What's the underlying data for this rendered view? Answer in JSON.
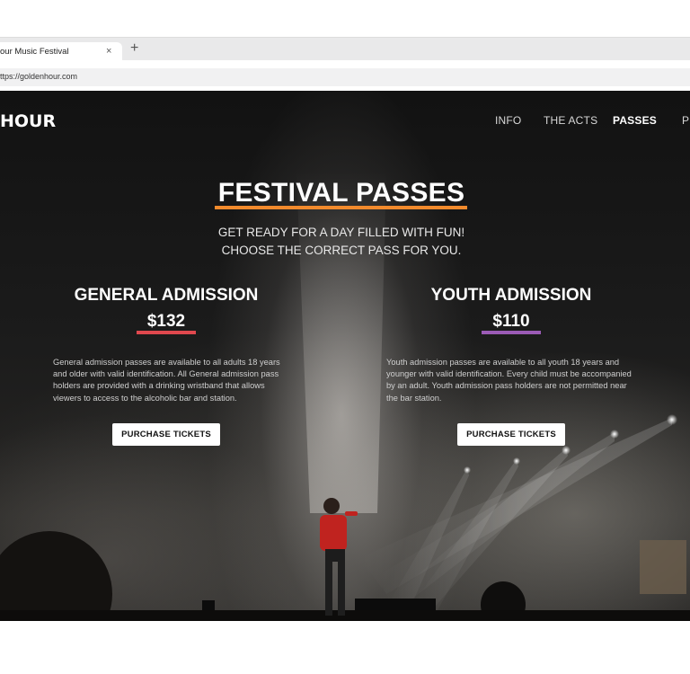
{
  "browser": {
    "tab_title": "our Music Festival",
    "tab_close": "×",
    "new_tab": "+",
    "url": "ttps://goldenhour.com"
  },
  "site": {
    "logo": "HOUR",
    "nav": [
      {
        "label": "INFO",
        "active": false
      },
      {
        "label": "THE ACTS",
        "active": false
      },
      {
        "label": "PASSES",
        "active": true
      },
      {
        "label": "PI",
        "active": false
      }
    ]
  },
  "hero": {
    "title": "FESTIVAL PASSES",
    "subtitle_line1": "GET READY FOR A DAY FILLED WITH FUN!",
    "subtitle_line2": "CHOOSE THE CORRECT PASS FOR YOU."
  },
  "passes": [
    {
      "name": "GENERAL ADMISSION",
      "price": "$132",
      "accent": "#e0484e",
      "description_lines": [
        "General admission passes are available to all adults 18 years",
        "and older with valid identification. All General admission pass",
        "holders are provided with a drinking wristband that allows",
        "viewers to access to the alcoholic bar and station."
      ],
      "button": "PURCHASE TICKETS"
    },
    {
      "name": "YOUTH ADMISSION",
      "price": "$110",
      "accent": "#9b5bb5",
      "description_lines": [
        "Youth admission passes are available to all youth 18 years and",
        "younger with valid identification. Every child must be accompanied",
        "by an adult. Youth admission pass holders are not permitted near",
        "the bar station."
      ],
      "button": "PURCHASE TICKETS"
    }
  ],
  "colors": {
    "hero_accent": "#f28a2c",
    "background": "#151515"
  }
}
